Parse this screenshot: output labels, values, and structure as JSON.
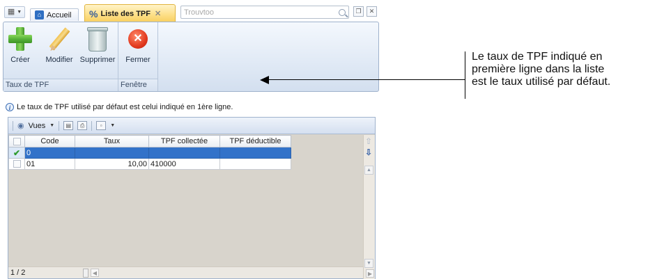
{
  "tabs": {
    "home_label": "Accueil",
    "active_label": "Liste des TPF"
  },
  "search": {
    "placeholder": "Trouvtoo"
  },
  "ribbon": {
    "buttons": [
      {
        "label": "Créer",
        "icon": "add-icon"
      },
      {
        "label": "Modifier",
        "icon": "pencil-icon"
      },
      {
        "label": "Supprimer",
        "icon": "trash-icon"
      },
      {
        "label": "Fermer",
        "icon": "close-circle-icon"
      }
    ],
    "groups": [
      "Taux de TPF",
      "Fenêtre"
    ]
  },
  "annotation": {
    "lines": [
      "Le taux de TPF indiqué en",
      "première ligne dans la liste",
      "est le taux utilisé par défaut."
    ]
  },
  "info_text": "Le taux de TPF utilisé par défaut est celui indiqué en 1ère ligne.",
  "toolbar": {
    "views_label": "Vues"
  },
  "grid": {
    "columns": [
      "Code",
      "Taux",
      "TPF collectée",
      "TPF déductible"
    ],
    "rows": [
      {
        "code": "0",
        "taux": "",
        "collectee": "",
        "deductible": "",
        "selected": true
      },
      {
        "code": "01",
        "taux": "10,00",
        "collectee": "410000",
        "deductible": "",
        "selected": false
      }
    ]
  },
  "status": {
    "page": "1 / 2"
  },
  "colors": {
    "selection": "#3272c9",
    "active_tab": "#fde08a"
  }
}
